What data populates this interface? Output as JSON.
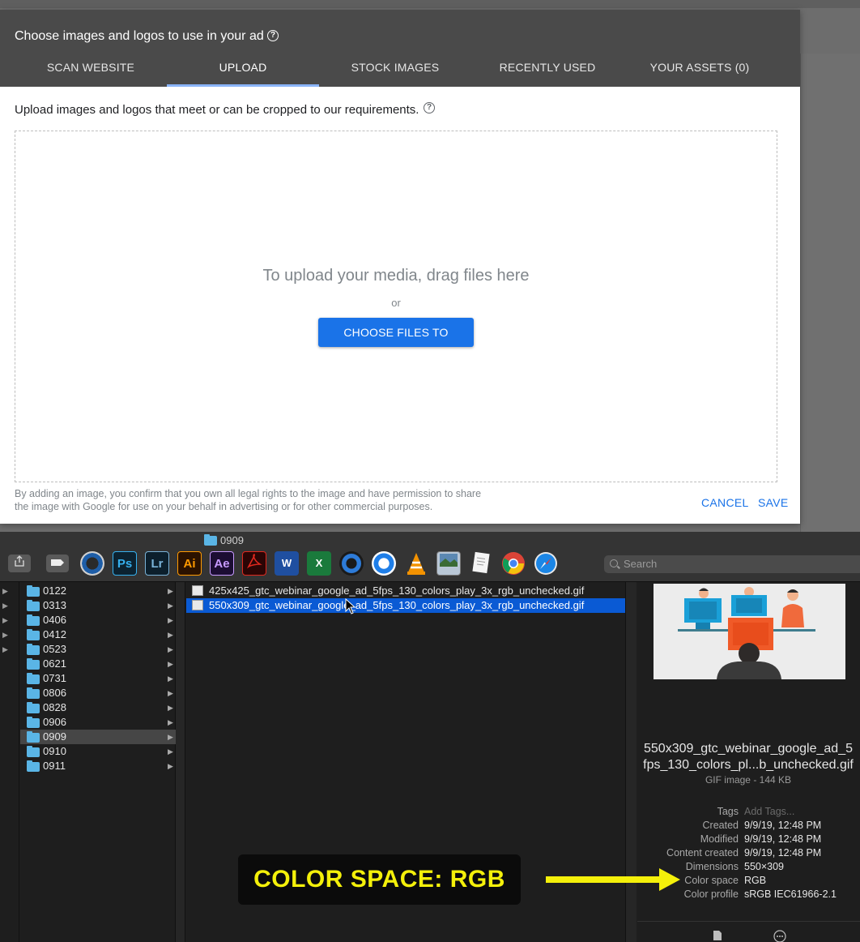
{
  "dialog": {
    "title": "Choose images and logos to use in your ad",
    "tabs": [
      {
        "label": "SCAN WEBSITE",
        "active": false
      },
      {
        "label": "UPLOAD",
        "active": true
      },
      {
        "label": "STOCK IMAGES",
        "active": false
      },
      {
        "label": "RECENTLY USED",
        "active": false
      },
      {
        "label": "YOUR ASSETS (0)",
        "active": false
      }
    ],
    "subtitle": "Upload images and logos that meet or can be cropped to our requirements.",
    "dropzone": {
      "heading": "To upload your media, drag files here",
      "or": "or",
      "button": "CHOOSE FILES TO UPLOAD"
    },
    "disclaimer_line1": "By adding an image, you confirm that you own all legal rights to the image and have permission to share",
    "disclaimer_line2": "the image with Google for use on your behalf in advertising or for other commercial purposes.",
    "cancel": "CANCEL",
    "save": "SAVE",
    "accent_color": "#1a73e8"
  },
  "finder": {
    "window_title": "0909",
    "search_placeholder": "Search",
    "dock_icons": [
      "share-icon",
      "tag-icon",
      "cinema4d-icon",
      "photoshop-icon",
      "lightroom-icon",
      "illustrator-icon",
      "aftereffects-icon",
      "acrobat-icon",
      "word-icon",
      "excel-icon",
      "quicktime-icon",
      "quicktime-blue-icon",
      "vlc-icon",
      "preview-icon",
      "textedit-icon",
      "chrome-icon",
      "safari-icon"
    ],
    "dock_labels": {
      "ps": "Ps",
      "lr": "Lr",
      "ai": "Ai",
      "ae": "Ae",
      "w": "W",
      "x": "X"
    },
    "folders": [
      {
        "name": "0122",
        "selected": false
      },
      {
        "name": "0313",
        "selected": false
      },
      {
        "name": "0406",
        "selected": false
      },
      {
        "name": "0412",
        "selected": false
      },
      {
        "name": "0523",
        "selected": false
      },
      {
        "name": "0621",
        "selected": false
      },
      {
        "name": "0731",
        "selected": false
      },
      {
        "name": "0806",
        "selected": false
      },
      {
        "name": "0828",
        "selected": false
      },
      {
        "name": "0906",
        "selected": false
      },
      {
        "name": "0909",
        "selected": true
      },
      {
        "name": "0910",
        "selected": false
      },
      {
        "name": "0911",
        "selected": false
      }
    ],
    "files": [
      {
        "name": "425x425_gtc_webinar_google_ad_5fps_130_colors_play_3x_rgb_unchecked.gif",
        "selected": false
      },
      {
        "name": "550x309_gtc_webinar_google_ad_5fps_130_colors_play_3x_rgb_unchecked.gif",
        "selected": true
      }
    ],
    "preview": {
      "name_line1": "550x309_gtc_webinar_google_ad_5",
      "name_line2": "fps_130_colors_pl...b_unchecked.gif",
      "kind": "GIF image - 144 KB",
      "meta": [
        {
          "key": "Tags",
          "value": "Add Tags...",
          "placeholder": true
        },
        {
          "key": "Created",
          "value": "9/9/19, 12:48 PM",
          "placeholder": false
        },
        {
          "key": "Modified",
          "value": "9/9/19, 12:48 PM",
          "placeholder": false
        },
        {
          "key": "Content created",
          "value": "9/9/19, 12:48 PM",
          "placeholder": false
        },
        {
          "key": "Dimensions",
          "value": "550×309",
          "placeholder": false
        },
        {
          "key": "Color space",
          "value": "RGB",
          "placeholder": false
        },
        {
          "key": "Color profile",
          "value": "sRGB IEC61966-2.1",
          "placeholder": false
        }
      ]
    },
    "selection_color": "#0a5ad4"
  },
  "annotation": {
    "text": "COLOR SPACE: RGB",
    "color": "#f4f00a"
  }
}
